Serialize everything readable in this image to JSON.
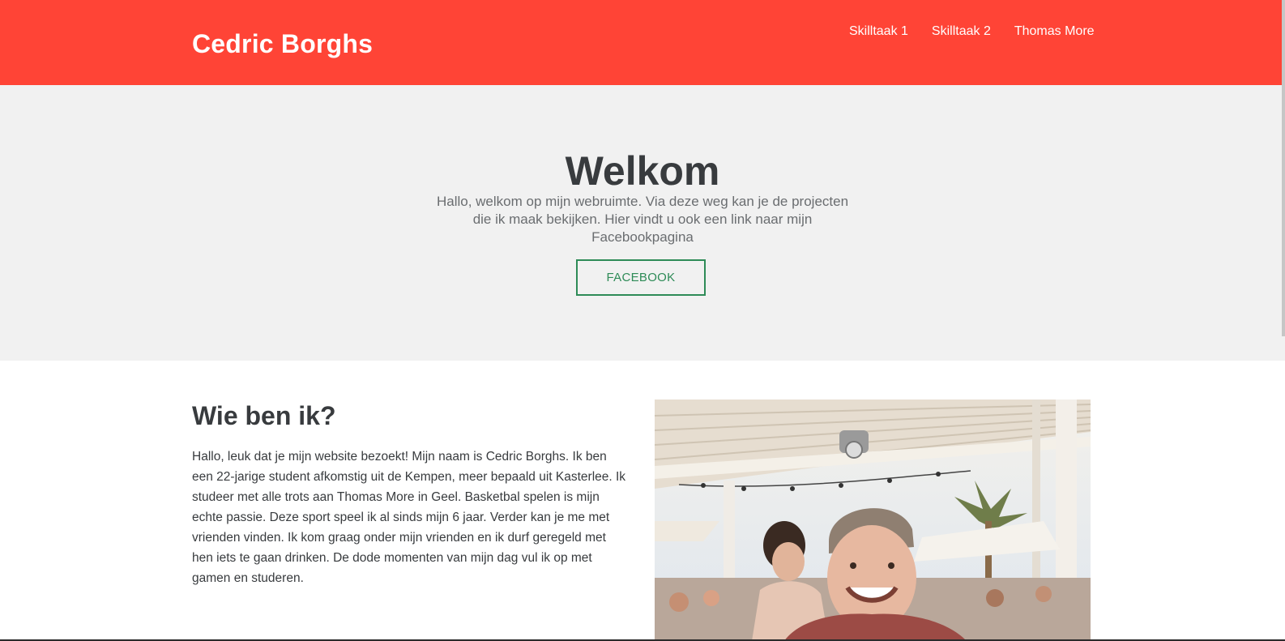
{
  "header": {
    "brand": "Cedric Borghs",
    "nav": [
      "Skilltaak 1",
      "Skilltaak 2",
      "Thomas More"
    ]
  },
  "hero": {
    "title": "Welkom",
    "text": "Hallo, welkom op mijn webruimte. Via deze weg kan je de projecten die ik maak bekijken. Hier vindt u ook een link naar mijn Facebookpagina",
    "button": "FACEBOOK"
  },
  "about": {
    "title": "Wie ben ik?",
    "text": "Hallo, leuk dat je mijn website bezoekt! Mijn naam is Cedric Borghs. Ik ben een 22-jarige student afkomstig uit de Kempen, meer bepaald uit Kasterlee. Ik studeer met alle trots aan Thomas More in Geel. Basketbal spelen is mijn echte passie. Deze sport speel ik al sinds mijn 6 jaar. Verder kan je me met vrienden vinden. Ik kom graag onder mijn vrienden en ik durf geregeld met hen iets te gaan drinken. De dode momenten van mijn dag vul ik op met gamen en studeren."
  },
  "colors": {
    "header": "#ff4436",
    "hero_bg": "#f1f1f1",
    "button_accent": "#2e8b57",
    "text": "#383b3e"
  },
  "icons": {
    "photo": "profile-photo"
  }
}
